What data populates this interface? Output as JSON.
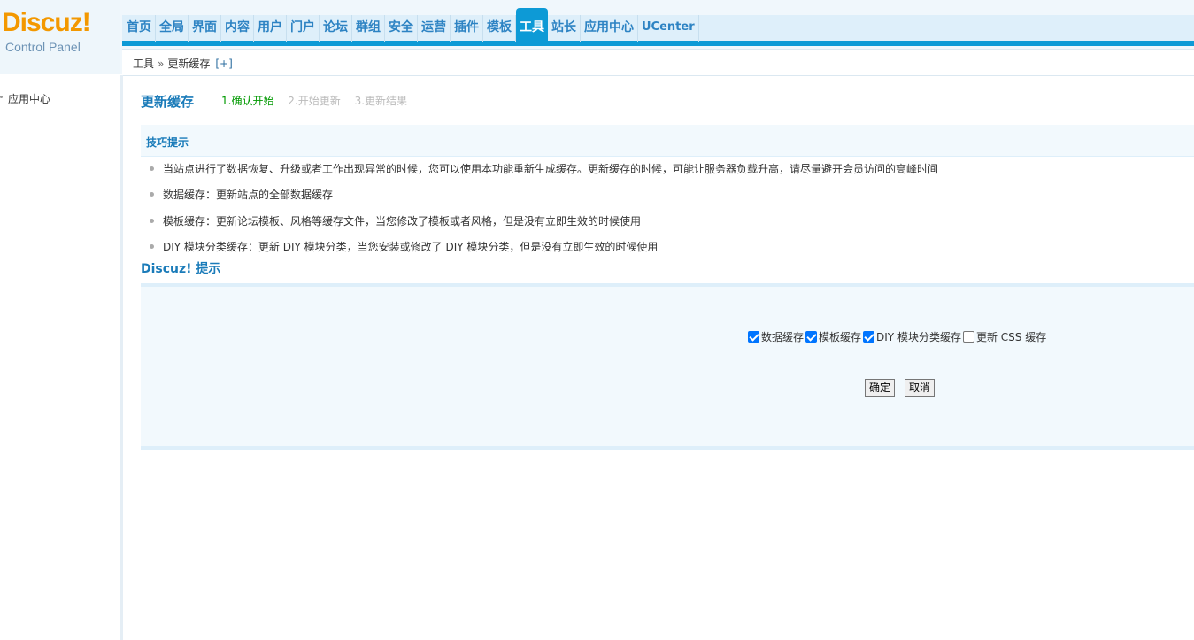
{
  "logo": {
    "brand": "Discuz!",
    "subtitle": "Control Panel"
  },
  "nav": {
    "items": [
      {
        "label": "首页"
      },
      {
        "label": "全局"
      },
      {
        "label": "界面"
      },
      {
        "label": "内容"
      },
      {
        "label": "用户"
      },
      {
        "label": "门户"
      },
      {
        "label": "论坛"
      },
      {
        "label": "群组"
      },
      {
        "label": "安全"
      },
      {
        "label": "运营"
      },
      {
        "label": "插件"
      },
      {
        "label": "模板"
      },
      {
        "label": "工具"
      },
      {
        "label": "站长"
      },
      {
        "label": "应用中心"
      },
      {
        "label": "UCenter"
      }
    ],
    "active_index": 12
  },
  "breadcrumb": {
    "parent": "工具",
    "separator": "»",
    "current": "更新缓存",
    "add": "[+]"
  },
  "sidebar": {
    "items": [
      {
        "label": "应用中心"
      }
    ]
  },
  "page": {
    "title": "更新缓存",
    "steps": [
      "1.确认开始",
      "2.开始更新",
      "3.更新结果"
    ],
    "current_step": 0
  },
  "tips": {
    "title": "技巧提示",
    "items": [
      "当站点进行了数据恢复、升级或者工作出现异常的时候，您可以使用本功能重新生成缓存。更新缓存的时候，可能让服务器负载升高，请尽量避开会员访问的高峰时间",
      "数据缓存：更新站点的全部数据缓存",
      "模板缓存：更新论坛模板、风格等缓存文件，当您修改了模板或者风格，但是没有立即生效的时候使用",
      "DIY 模块分类缓存：更新 DIY 模块分类，当您安装或修改了 DIY 模块分类，但是没有立即生效的时候使用"
    ]
  },
  "prompt": {
    "title": "Discuz! 提示",
    "options": [
      {
        "label": "数据缓存",
        "checked": true
      },
      {
        "label": "模板缓存",
        "checked": true
      },
      {
        "label": "DIY 模块分类缓存",
        "checked": true
      },
      {
        "label": "更新 CSS 缓存",
        "checked": false
      }
    ],
    "confirm_label": "确定",
    "cancel_label": "取消"
  }
}
